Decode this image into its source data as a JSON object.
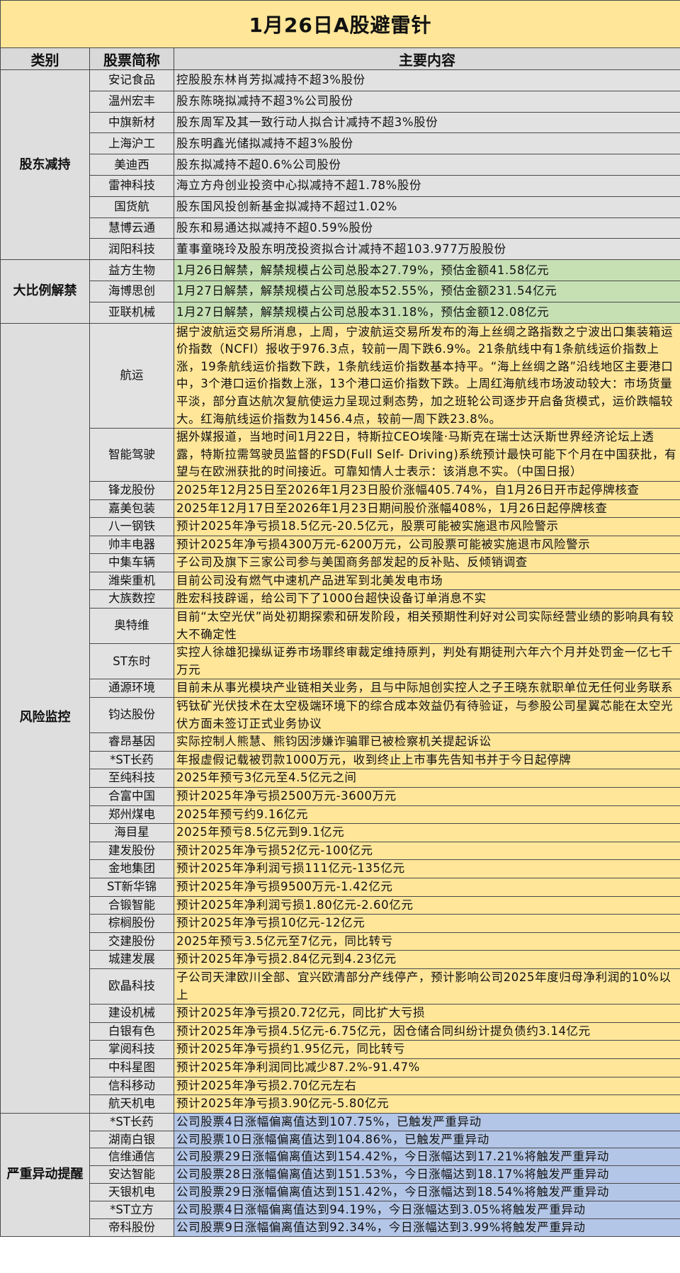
{
  "title": "1月26日A股避雷针",
  "headers": {
    "category": "类别",
    "stock": "股票简称",
    "content": "主要内容"
  },
  "sections": [
    {
      "category": "股东减持",
      "style": "s1",
      "rows": [
        {
          "stock": "安记食品",
          "content": "控股股东林肖芳拟减持不超3%股份"
        },
        {
          "stock": "温州宏丰",
          "content": "股东陈晓拟减持不超3%公司股份"
        },
        {
          "stock": "中旗新材",
          "content": "股东周军及其一致行动人拟合计减持不超3%股份"
        },
        {
          "stock": "上海沪工",
          "content": "股东明鑫光储拟减持不超3%股份"
        },
        {
          "stock": "美迪西",
          "content": "股东拟减持不超0.6%公司股份"
        },
        {
          "stock": "雷神科技",
          "content": "海立方舟创业投资中心拟减持不超1.78%股份"
        },
        {
          "stock": "国货航",
          "content": "股东国风投创新基金拟减持不超过1.02%"
        },
        {
          "stock": "慧博云通",
          "content": "股东和易通达拟减持不超0.59%股份"
        },
        {
          "stock": "润阳科技",
          "content": "董事童晓玲及股东明茂投资拟合计减持不超103.977万股股份"
        }
      ]
    },
    {
      "category": "大比例解禁",
      "style": "s2",
      "rows": [
        {
          "stock": "益方生物",
          "content": "1月26日解禁，解禁规模占公司总股本27.79%，预估金额41.58亿元"
        },
        {
          "stock": "海博思创",
          "content": "1月27日解禁，解禁规模占公司总股本52.55%，预估金额231.54亿元"
        },
        {
          "stock": "亚联机械",
          "content": "1月27日解禁，解禁规模占公司总股本31.18%，预估金额12.08亿元"
        }
      ]
    },
    {
      "category": "风险监控",
      "style": "s3",
      "rows": [
        {
          "stock": "航运",
          "content": "据宁波航运交易所消息，上周，宁波航运交易所发布的海上丝绸之路指数之宁波出口集装箱运价指数（NCFI）报收于976.3点，较前一周下跌6.9%。21条航线中有1条航线运价指数上涨，19条航线运价指数下跌，1条航线运价指数基本持平。“海上丝绸之路”沿线地区主要港口中，3个港口运价指数上涨，13个港口运价指数下跌。上周红海航线市场波动较大：市场货量平淡，部分直达航次复航使运力呈现过剩态势，加之班轮公司逐步开启备货模式，运价跌幅较大。红海航线运价指数为1456.4点，较前一周下跌23.8%。"
        },
        {
          "stock": "智能驾驶",
          "content": "据外媒报道，当地时间1月22日，特斯拉CEO埃隆·马斯克在瑞士达沃斯世界经济论坛上透露，特斯拉需驾驶员监督的FSD(Full Self- Driving)系统预计最快可能下个月在中国获批，有望与在欧洲获批的时间接近。可靠知情人士表示：该消息不实。（中国日报）"
        },
        {
          "stock": "锋龙股份",
          "content": "2025年12月25日至2026年1月23日股价涨幅405.74%，自1月26日开市起停牌核查"
        },
        {
          "stock": "嘉美包装",
          "content": "2025年12月17日至2026年1月23日期间股价涨幅408%，1月26日起停牌核查"
        },
        {
          "stock": "八一钢铁",
          "content": "预计2025年净亏损18.5亿元-20.5亿元，股票可能被实施退市风险警示"
        },
        {
          "stock": "帅丰电器",
          "content": "预计2025年净亏损4300万元-6200万元，公司股票可能被实施退市风险警示"
        },
        {
          "stock": "中集车辆",
          "content": "子公司及旗下三家公司参与美国商务部发起的反补贴、反倾销调查"
        },
        {
          "stock": "潍柴重机",
          "content": "目前公司没有燃气中速机产品进军到北美发电市场"
        },
        {
          "stock": "大族数控",
          "content": "胜宏科技辟谣，给公司下了1000台超快设备订单消息不实"
        },
        {
          "stock": "奥特维",
          "content": "目前“太空光伏”尚处初期探索和研发阶段，相关预期性利好对公司实际经营业绩的影响具有较大不确定性"
        },
        {
          "stock": "ST东时",
          "content": "实控人徐雄犯操纵证券市场罪终审裁定维持原判，判处有期徒刑六年六个月并处罚金一亿七千万元"
        },
        {
          "stock": "通源环境",
          "content": "目前未从事光模块产业链相关业务，且与中际旭创实控人之子王晓东就职单位无任何业务联系"
        },
        {
          "stock": "钧达股份",
          "content": "钙钛矿光伏技术在太空极端环境下的综合成本效益仍有待验证，与参股公司星翼芯能在太空光伏方面未签订正式业务协议"
        },
        {
          "stock": "睿昂基因",
          "content": "实际控制人熊慧、熊钧因涉嫌诈骗罪已被检察机关提起诉讼"
        },
        {
          "stock": "*ST长药",
          "content": "年报虚假记载被罚款1000万元，收到终止上市事先告知书并于今日起停牌"
        },
        {
          "stock": "至纯科技",
          "content": "2025年预亏3亿元至4.5亿元之间"
        },
        {
          "stock": "合富中国",
          "content": "预计2025年净亏损2500万元-3600万元"
        },
        {
          "stock": "郑州煤电",
          "content": "2025年预亏约9.16亿元"
        },
        {
          "stock": "海目星",
          "content": "2025年预亏8.5亿元到9.1亿元"
        },
        {
          "stock": "建发股份",
          "content": "预计2025年净亏损52亿元-100亿元"
        },
        {
          "stock": "金地集团",
          "content": "预计2025年净利润亏损111亿元-135亿元"
        },
        {
          "stock": "ST新华锦",
          "content": "预计2025年净亏损9500万元-1.42亿元"
        },
        {
          "stock": "合锻智能",
          "content": "预计2025年净利润亏损1.80亿元-2.60亿元"
        },
        {
          "stock": "棕榈股份",
          "content": "预计2025年净亏损10亿元-12亿元"
        },
        {
          "stock": "交建股份",
          "content": "2025年预亏3.5亿元至7亿元，同比转亏"
        },
        {
          "stock": "城建发展",
          "content": "预计2025年净亏损2.84亿元到4.23亿元"
        },
        {
          "stock": "欧晶科技",
          "content": "子公司天津欧川全部、宜兴欧清部分产线停产，预计影响公司2025年度归母净利润的10%以上"
        },
        {
          "stock": "建设机械",
          "content": "预计2025年净亏损20.72亿元，同比扩大亏损"
        },
        {
          "stock": "白银有色",
          "content": "预计2025年净亏损4.5亿元-6.75亿元，因仓储合同纠纷计提负债约3.14亿元"
        },
        {
          "stock": "掌阅科技",
          "content": "预计2025年净亏损约1.95亿元，同比转亏"
        },
        {
          "stock": "中科星图",
          "content": "预计2025年净利润同比减少87.2%-91.47%"
        },
        {
          "stock": "信科移动",
          "content": "预计2025年净亏损2.70亿元左右"
        },
        {
          "stock": "航天机电",
          "content": "预计2025年净亏损3.90亿元-5.80亿元"
        }
      ]
    },
    {
      "category": "严重异动提醒",
      "style": "s4",
      "rows": [
        {
          "stock": "*ST长药",
          "content": "公司股票4日涨幅偏离值达到107.75%，已触发严重异动"
        },
        {
          "stock": "湖南白银",
          "content": "公司股票10日涨幅偏离值达到104.86%，已触发严重异动"
        },
        {
          "stock": "信维通信",
          "content": "公司股票29日涨幅偏离值达到154.42%，今日涨幅达到17.21%将触发严重异动"
        },
        {
          "stock": "安达智能",
          "content": "公司股票28日涨幅偏离值达到151.53%，今日涨幅达到18.17%将触发严重异动"
        },
        {
          "stock": "天银机电",
          "content": "公司股票29日涨幅偏离值达到151.42%，今日涨幅达到18.54%将触发严重异动"
        },
        {
          "stock": "*ST立方",
          "content": "公司股票4日涨幅偏离值达到94.19%，今日涨幅达到3.05%将触发严重异动"
        },
        {
          "stock": "帝科股份",
          "content": "公司股票9日涨幅偏离值达到92.34%，今日涨幅达到3.99%将触发严重异动"
        }
      ]
    }
  ]
}
